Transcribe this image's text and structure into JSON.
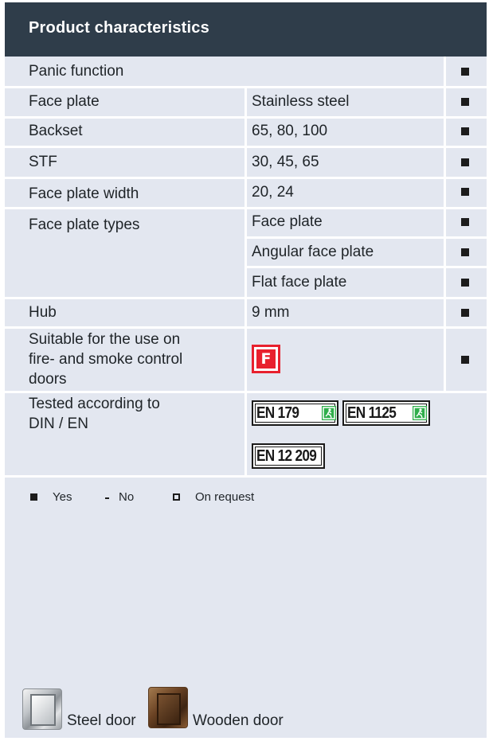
{
  "header": {
    "title": "Product characteristics"
  },
  "rows": {
    "panic": {
      "label": "Panic function"
    },
    "face_plate": {
      "label": "Face plate",
      "value": "Stainless steel"
    },
    "backset": {
      "label": "Backset",
      "value": "65, 80, 100"
    },
    "stf": {
      "label": "STF",
      "value": "30, 45, 65"
    },
    "face_plate_width": {
      "label": "Face plate width",
      "value": "20, 24"
    },
    "face_plate_types": {
      "label": "Face plate types",
      "values": [
        "Face plate",
        "Angular face plate",
        "Flat face plate"
      ]
    },
    "hub": {
      "label": "Hub",
      "value": "9 mm"
    },
    "fire": {
      "label_lines": [
        "Suitable for the use on",
        "fire- and smoke control",
        "doors"
      ],
      "badge": "F"
    },
    "tested": {
      "label_lines": [
        "Tested according to",
        "DIN / EN"
      ],
      "badges": [
        "EN 179",
        "EN 1125",
        "EN 12 209"
      ]
    }
  },
  "legend": {
    "yes": "Yes",
    "no": "No",
    "on_request": "On request"
  },
  "doors": {
    "steel": "Steel door",
    "wooden": "Wooden door"
  },
  "colors": {
    "header_bg": "#2f3d4a",
    "panel_bg": "#e3e7f0",
    "fire_badge": "#e8212e",
    "exit_green": "#2fae4b"
  },
  "icons": {
    "yes_marker": "filled-square-icon",
    "no_marker": "dash-icon",
    "on_request_marker": "open-square-icon",
    "exit": "emergency-exit-icon"
  }
}
